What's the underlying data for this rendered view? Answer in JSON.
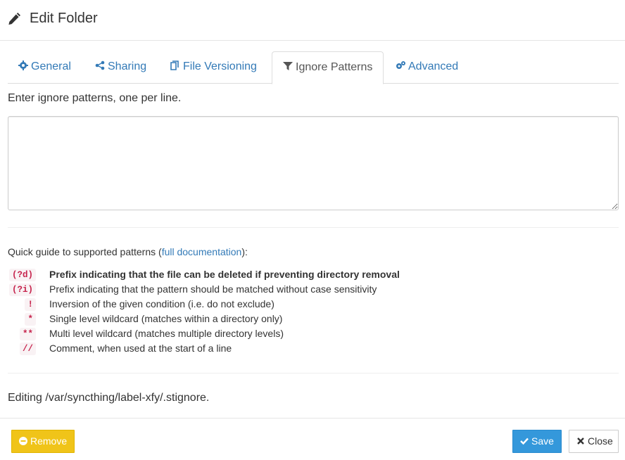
{
  "header": {
    "title": "Edit Folder",
    "icon": "pencil-icon"
  },
  "tabs": [
    {
      "label": "General",
      "icon": "gear-icon",
      "active": false
    },
    {
      "label": "Sharing",
      "icon": "share-icon",
      "active": false
    },
    {
      "label": "File Versioning",
      "icon": "copy-icon",
      "active": false
    },
    {
      "label": "Ignore Patterns",
      "icon": "filter-icon",
      "active": true
    },
    {
      "label": "Advanced",
      "icon": "gears-icon",
      "active": false
    }
  ],
  "ignore": {
    "help": "Enter ignore patterns, one per line.",
    "textarea_value": ""
  },
  "guide": {
    "intro_prefix": "Quick guide to supported patterns (",
    "doc_link": "full documentation",
    "intro_suffix": "):",
    "patterns": [
      {
        "code": "(?d)",
        "desc": "Prefix indicating that the file can be deleted if preventing directory removal",
        "bold": true
      },
      {
        "code": "(?i)",
        "desc": "Prefix indicating that the pattern should be matched without case sensitivity",
        "bold": false
      },
      {
        "code": "!",
        "desc": "Inversion of the given condition (i.e. do not exclude)",
        "bold": false
      },
      {
        "code": "*",
        "desc": "Single level wildcard (matches within a directory only)",
        "bold": false
      },
      {
        "code": "**",
        "desc": "Multi level wildcard (matches multiple directory levels)",
        "bold": false
      },
      {
        "code": "//",
        "desc": "Comment, when used at the start of a line",
        "bold": false
      }
    ]
  },
  "editing": "Editing /var/syncthing/label-xfy/.stignore.",
  "footer": {
    "remove_label": "Remove",
    "save_label": "Save",
    "close_label": "Close"
  },
  "colors": {
    "link": "#337ab7",
    "remove_button": "#f0c419",
    "save_button": "#3498db",
    "code_text": "#c7254e",
    "code_bg": "#f9f2f4"
  }
}
